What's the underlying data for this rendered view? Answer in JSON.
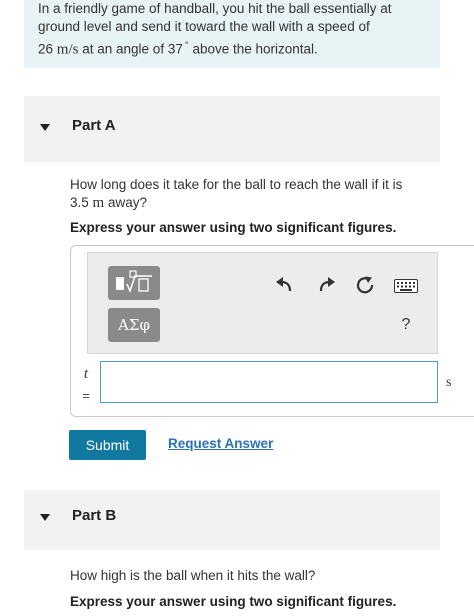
{
  "intro": {
    "line1": "In a friendly game of handball, you hit the ball essentially at",
    "line2": "ground level and send it toward the wall with a speed of",
    "speed_value": "26",
    "speed_unit": "m/s",
    "line3_mid": "at an angle of 37",
    "degree_symbol": "°",
    "line3_end": "above the horizontal."
  },
  "part_a": {
    "title": "Part A",
    "question_line1": "How long does it take for the ball to reach the wall if it is",
    "distance_value": "3.5",
    "distance_unit": "m",
    "question_tail": "away?",
    "instruction": "Express your answer using two significant figures.",
    "greek_label": "ΑΣφ",
    "help_label": "?",
    "variable": "t",
    "equals": "=",
    "answer_value": "",
    "unit": "s",
    "submit_label": "Submit",
    "request_label": "Request Answer"
  },
  "part_b": {
    "title": "Part B",
    "question": "How high is the ball when it hits the wall?",
    "instruction": "Express your answer using two significant figures."
  },
  "colors": {
    "intro_bg": "#e7f3f5",
    "part_header_bg": "#f2f2f2",
    "submit_bg": "#1178a0",
    "link": "#2a72b5",
    "input_border": "#4d9dc3"
  },
  "icons": [
    "collapse-triangle-icon",
    "template-icon",
    "undo-icon",
    "redo-icon",
    "reset-icon",
    "keyboard-icon"
  ]
}
